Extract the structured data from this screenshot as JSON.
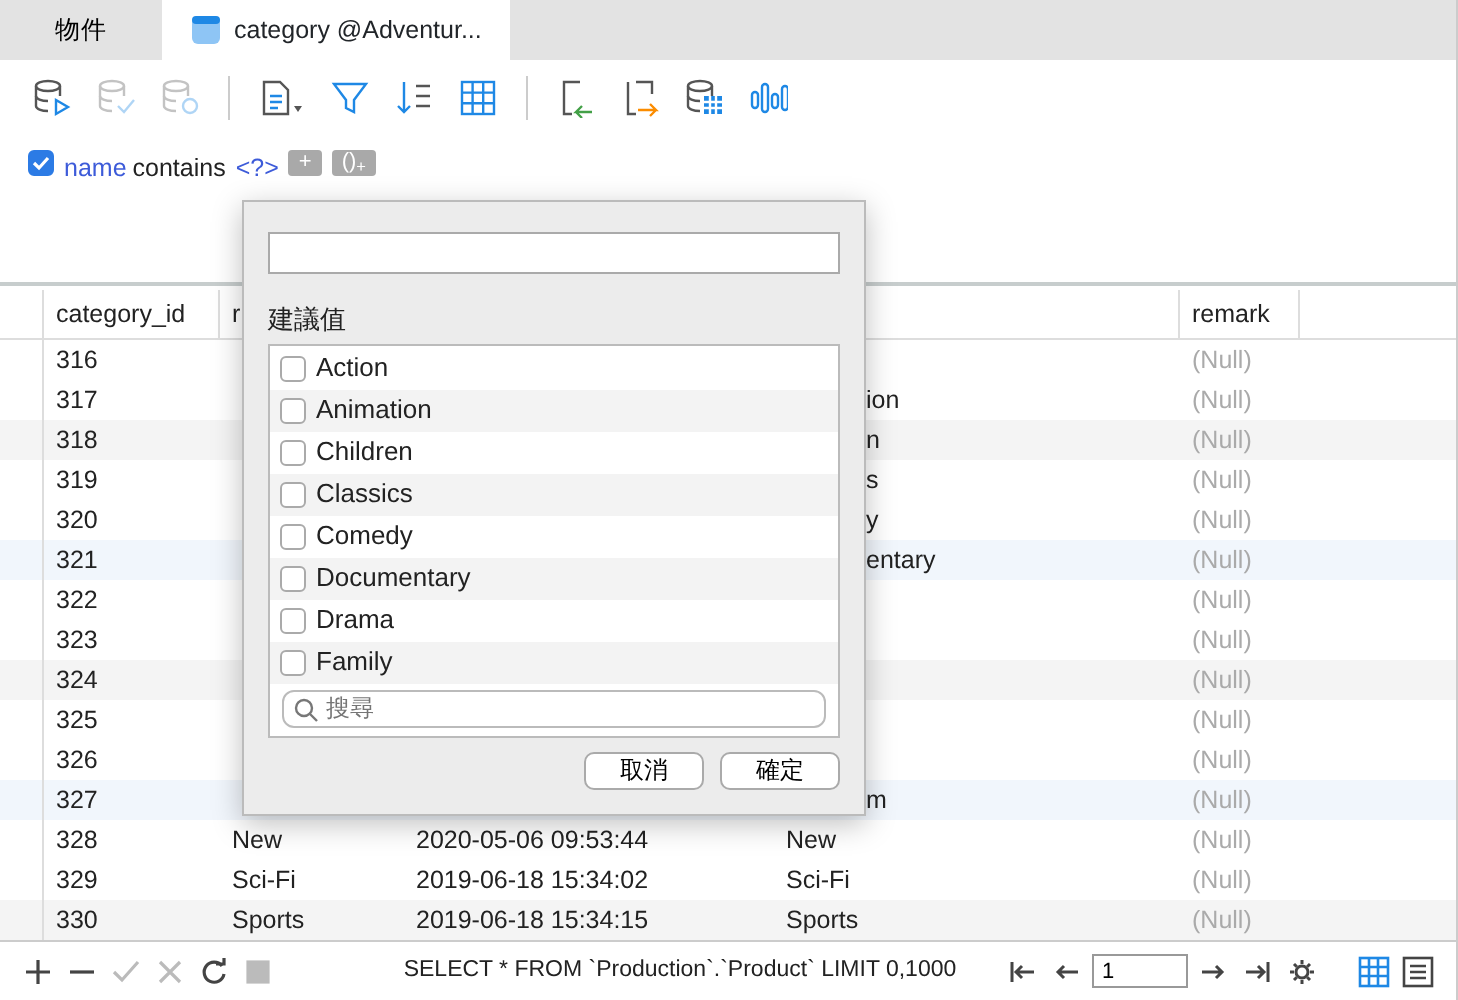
{
  "tabs": [
    {
      "label": "物件",
      "selected": false,
      "kind": "plain"
    },
    {
      "label": "category @Adventur...",
      "selected": true,
      "kind": "table"
    }
  ],
  "toolbar": [
    {
      "kind": "db-run",
      "disabled": false
    },
    {
      "kind": "db-check",
      "disabled": true
    },
    {
      "kind": "db-revert",
      "disabled": true
    },
    {
      "kind": "sep"
    },
    {
      "kind": "doc",
      "disabled": false
    },
    {
      "kind": "filter",
      "disabled": false
    },
    {
      "kind": "sort",
      "disabled": false
    },
    {
      "kind": "grid",
      "disabled": false
    },
    {
      "kind": "sep"
    },
    {
      "kind": "import",
      "disabled": false
    },
    {
      "kind": "export",
      "disabled": false
    },
    {
      "kind": "db-grid",
      "disabled": false
    },
    {
      "kind": "chart",
      "disabled": false
    }
  ],
  "filter": {
    "checked": true,
    "field": "name",
    "operator": "contains",
    "value": "<?>",
    "buttons": [
      "+",
      "()$_{+}$"
    ]
  },
  "table": {
    "columns": [
      "category_id",
      "r",
      "",
      "",
      "remark"
    ],
    "rows": [
      {
        "cells": [
          "316",
          "",
          "",
          "",
          "(Null)"
        ]
      },
      {
        "cells": [
          "317",
          "",
          "",
          "ion",
          "(Null)"
        ],
        "under_popup": true
      },
      {
        "cells": [
          "318",
          "",
          "",
          "n",
          "(Null)"
        ],
        "under_popup": true,
        "color": "#f4f4f4"
      },
      {
        "cells": [
          "319",
          "",
          "",
          "s",
          "(Null)"
        ],
        "under_popup": true
      },
      {
        "cells": [
          "320",
          "",
          "",
          "y",
          "(Null)"
        ],
        "under_popup": true
      },
      {
        "cells": [
          "321",
          "",
          "",
          "entary",
          "(Null)"
        ],
        "under_popup": true,
        "color": "#f1f6fc"
      },
      {
        "cells": [
          "322",
          "",
          "",
          "",
          "(Null)"
        ]
      },
      {
        "cells": [
          "323",
          "",
          "",
          "",
          "(Null)"
        ]
      },
      {
        "cells": [
          "324",
          "",
          "",
          "",
          "(Null)"
        ],
        "color": "#f4f4f4"
      },
      {
        "cells": [
          "325",
          "",
          "",
          "",
          "(Null)"
        ]
      },
      {
        "cells": [
          "326",
          "",
          "",
          "",
          "(Null)"
        ]
      },
      {
        "cells": [
          "327",
          "",
          "",
          "m",
          "(Null)"
        ],
        "under_popup": true,
        "color": "#f1f6fc"
      },
      {
        "cells": [
          "328",
          "New",
          "2020-05-06 09:53:44",
          "New",
          "(Null)"
        ],
        "under_popup": false
      },
      {
        "cells": [
          "329",
          "Sci-Fi",
          "2019-06-18 15:34:02",
          "Sci-Fi",
          "(Null)"
        ],
        "under_popup": false
      },
      {
        "cells": [
          "330",
          "Sports",
          "2019-06-18 15:34:15",
          "Sports",
          "(Null)"
        ],
        "under_popup": false,
        "color": "#f4f4f4"
      }
    ]
  },
  "popup": {
    "section": "建議值",
    "options": [
      {
        "label": "Action",
        "checked": false
      },
      {
        "label": "Animation",
        "checked": false
      },
      {
        "label": "Children",
        "checked": false
      },
      {
        "label": "Classics",
        "checked": false
      },
      {
        "label": "Comedy",
        "checked": false
      },
      {
        "label": "Documentary",
        "checked": false
      },
      {
        "label": "Drama",
        "checked": false
      },
      {
        "label": "Family",
        "checked": false
      }
    ],
    "search_placeholder": "搜尋",
    "cancel": "取消",
    "ok": "確定"
  },
  "status_bar": {
    "actions": [
      {
        "kind": "add",
        "disabled": false
      },
      {
        "kind": "remove",
        "disabled": false
      },
      {
        "kind": "apply",
        "disabled": true
      },
      {
        "kind": "discard",
        "disabled": true
      },
      {
        "kind": "refresh",
        "disabled": false
      },
      {
        "kind": "stop",
        "disabled": true
      }
    ],
    "sql": "SELECT * FROM `Production`.`Product` LIMIT 0,1000",
    "page": "1",
    "views": [
      {
        "kind": "grid",
        "selected": true
      },
      {
        "kind": "form",
        "selected": false
      }
    ]
  }
}
